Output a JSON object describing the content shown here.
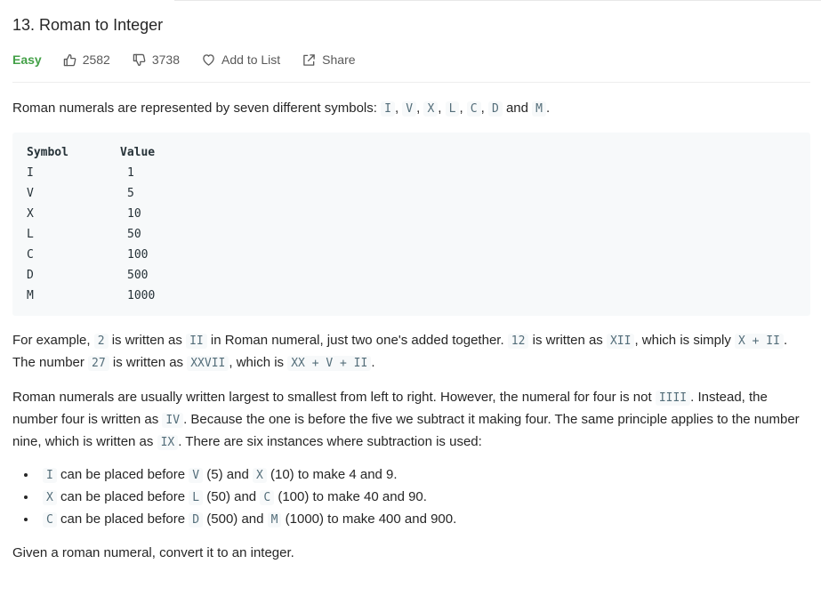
{
  "problem": {
    "title": "13. Roman to Integer",
    "difficulty": "Easy",
    "likes": "2582",
    "dislikes": "3738",
    "add_to_list_label": "Add to List",
    "share_label": "Share",
    "difficulty_color": "#43a047"
  },
  "content": {
    "intro": {
      "t1": "Roman numerals are represented by seven different symbols: ",
      "c1": "I",
      "s1": ", ",
      "c2": "V",
      "s2": ", ",
      "c3": "X",
      "s3": ", ",
      "c4": "L",
      "s4": ", ",
      "c5": "C",
      "s5": ", ",
      "c6": "D",
      "s6": " and ",
      "c7": "M",
      "s7": "."
    },
    "table": {
      "header_symbol": "Symbol",
      "header_value": "Value",
      "rows": [
        {
          "symbol": "I",
          "value": "1"
        },
        {
          "symbol": "V",
          "value": "5"
        },
        {
          "symbol": "X",
          "value": "10"
        },
        {
          "symbol": "L",
          "value": "50"
        },
        {
          "symbol": "C",
          "value": "100"
        },
        {
          "symbol": "D",
          "value": "500"
        },
        {
          "symbol": "M",
          "value": "1000"
        }
      ]
    },
    "example": {
      "t1": "For example, ",
      "c1": "2",
      "t2": " is written as ",
      "c2": "II",
      "t3": " in Roman numeral, just two one's added together. ",
      "c3": "12",
      "t4": " is written as ",
      "c4": "XII",
      "t5": ", which is simply ",
      "c5": "X + II",
      "t6": ". The number ",
      "c6": "27",
      "t7": " is written as ",
      "c7": "XXVII",
      "t8": ", which is ",
      "c8": "XX + V + II",
      "t9": "."
    },
    "subtraction": {
      "t1": "Roman numerals are usually written largest to smallest from left to right. However, the numeral for four is not ",
      "c1": "IIII",
      "t2": ". Instead, the number four is written as ",
      "c2": "IV",
      "t3": ". Because the one is before the five we subtract it making four. The same principle applies to the number nine, which is written as ",
      "c3": "IX",
      "t4": ". There are six instances where subtraction is used:"
    },
    "rules": [
      {
        "c1": "I",
        "t1": " can be placed before ",
        "c2": "V",
        "t2": " (5) and ",
        "c3": "X",
        "t3": " (10) to make 4 and 9."
      },
      {
        "c1": "X",
        "t1": " can be placed before ",
        "c2": "L",
        "t2": " (50) and ",
        "c3": "C",
        "t3": " (100) to make 40 and 90."
      },
      {
        "c1": "C",
        "t1": " can be placed before ",
        "c2": "D",
        "t2": " (500) and ",
        "c3": "M",
        "t3": " (1000) to make 400 and 900."
      }
    ],
    "task": "Given a roman numeral, convert it to an integer."
  }
}
